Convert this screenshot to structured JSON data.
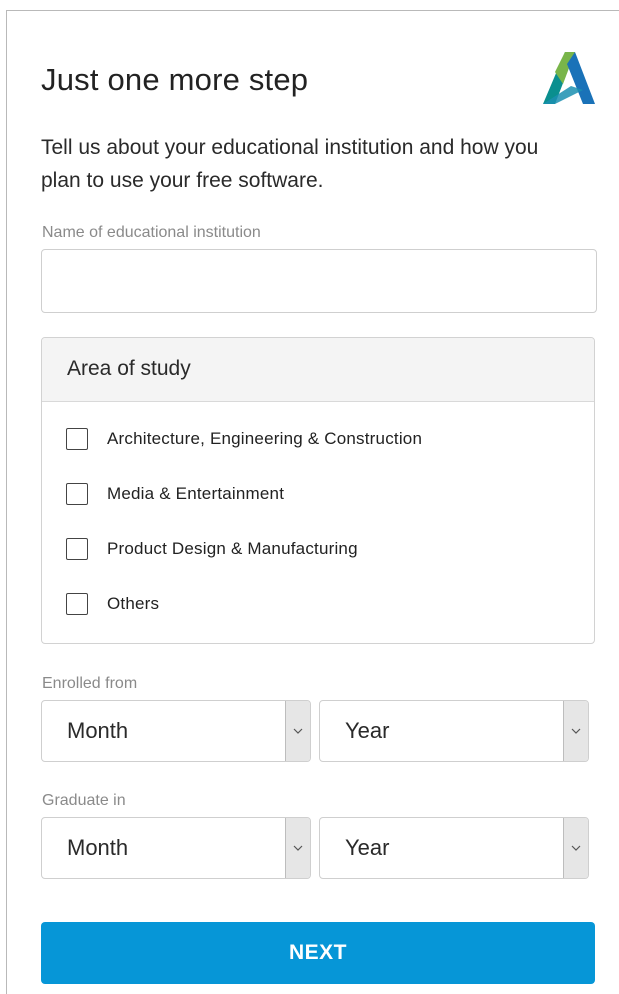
{
  "header": {
    "title": "Just one more step",
    "logo_icon": "autodesk-logo-icon"
  },
  "intro": {
    "text": "Tell us about your educational institution and how you plan to use your free software."
  },
  "institution": {
    "label": "Name of educational institution",
    "value": "",
    "placeholder": ""
  },
  "area_of_study": {
    "header": "Area of study",
    "options": [
      {
        "label": "Architecture, Engineering & Construction",
        "checked": false
      },
      {
        "label": "Media & Entertainment",
        "checked": false
      },
      {
        "label": "Product Design & Manufacturing",
        "checked": false
      },
      {
        "label": "Others",
        "checked": false
      }
    ]
  },
  "enrolled_from": {
    "label": "Enrolled from",
    "month": "Month",
    "year": "Year"
  },
  "graduate_in": {
    "label": "Graduate in",
    "month": "Month",
    "year": "Year"
  },
  "actions": {
    "next_label": "NEXT"
  },
  "colors": {
    "primary": "#0696d7",
    "logo_teal": "#0a8f8f",
    "logo_green": "#79b54a",
    "logo_blue": "#1a72b8"
  }
}
